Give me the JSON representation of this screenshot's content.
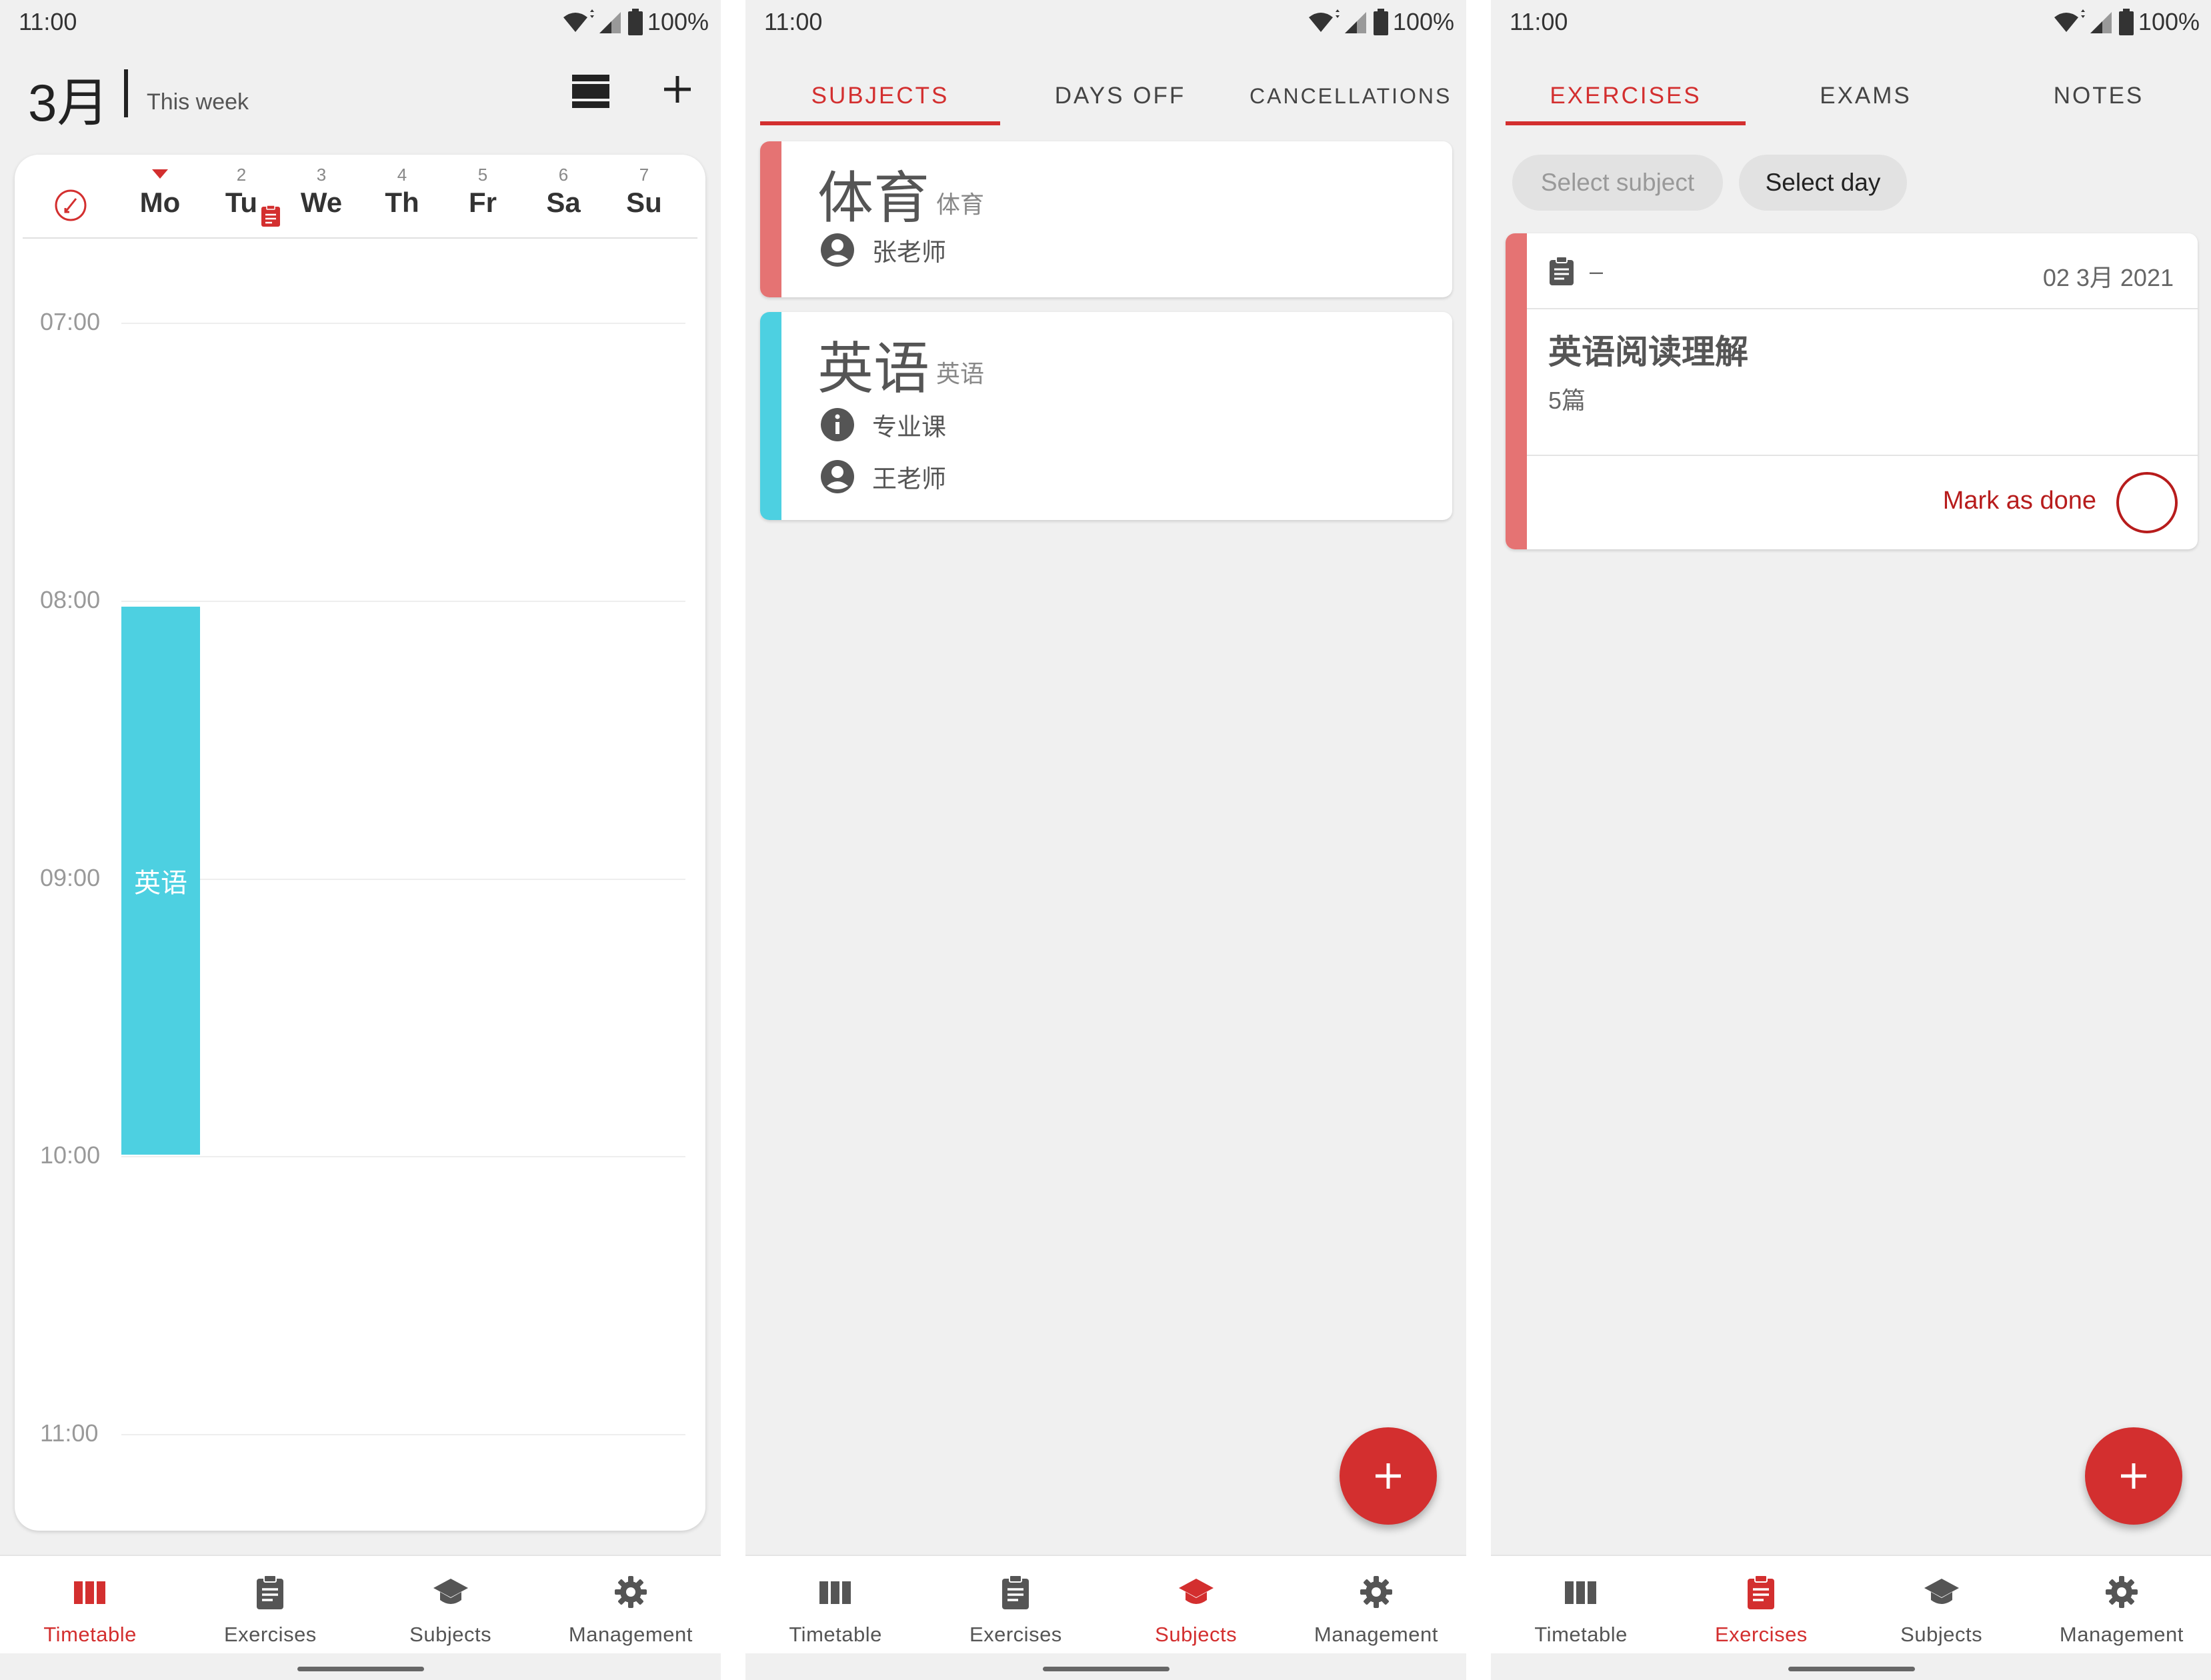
{
  "status_bar": {
    "time": "11:00",
    "battery": "100%"
  },
  "colors": {
    "accent": "#d32f2f",
    "english": "#4dd0e1",
    "pe": "#e57373",
    "mark_done": "#b71c1c"
  },
  "nav": {
    "timetable": "Timetable",
    "exercises": "Exercises",
    "subjects": "Subjects",
    "management": "Management"
  },
  "timetable": {
    "month": "3月",
    "range": "This week",
    "days": [
      {
        "num": "",
        "name": "Mo"
      },
      {
        "num": "2",
        "name": "Tu"
      },
      {
        "num": "3",
        "name": "We"
      },
      {
        "num": "4",
        "name": "Th"
      },
      {
        "num": "5",
        "name": "Fr"
      },
      {
        "num": "6",
        "name": "Sa"
      },
      {
        "num": "7",
        "name": "Su"
      }
    ],
    "hours": [
      "07:00",
      "08:00",
      "09:00",
      "10:00",
      "11:00"
    ],
    "event": {
      "label": "英语"
    }
  },
  "subjects_screen": {
    "tabs": [
      "SUBJECTS",
      "DAYS OFF",
      "CANCELLATIONS"
    ],
    "cards": [
      {
        "title": "体育",
        "short": "体育",
        "teacher": "张老师"
      },
      {
        "title": "英语",
        "short": "英语",
        "info": "专业课",
        "teacher": "王老师"
      }
    ]
  },
  "exercises_screen": {
    "tabs": [
      "EXERCISES",
      "EXAMS",
      "NOTES"
    ],
    "filters": {
      "subject": "Select subject",
      "day": "Select day"
    },
    "card": {
      "subject": "–",
      "date": "02 3月 2021",
      "title": "英语阅读理解",
      "detail": "5篇",
      "mark_done": "Mark as done"
    }
  }
}
